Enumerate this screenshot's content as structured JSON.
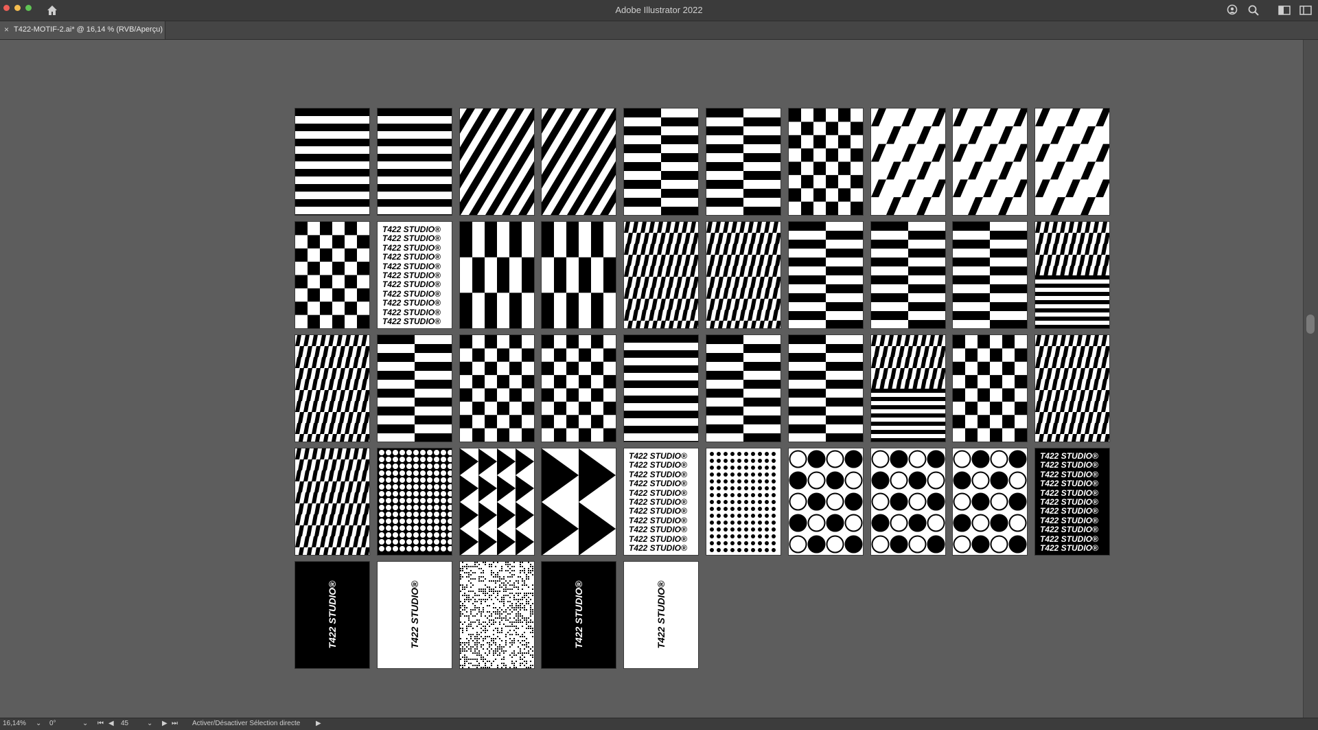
{
  "window": {
    "title": "Adobe Illustrator 2022"
  },
  "tab": {
    "label": "T422-MOTIF-2.ai* @ 16,14 % (RVB/Aperçu)",
    "close_glyph": "×"
  },
  "brand_text": "T422 STUDIO",
  "brand_mark": "®",
  "status": {
    "zoom": "16,14%",
    "rotation": "0°",
    "artboard_number": "45",
    "tool_hint": "Activer/Désactiver Sélection directe"
  },
  "artboard_patterns": [
    "hstripes",
    "hstripes",
    "diag",
    "diag",
    "hcheck",
    "hcheck",
    "check",
    "diagcheck",
    "diagcheck",
    "diagcheck",
    "check",
    "text-white",
    "vcheck",
    "vcheck",
    "skew",
    "skew",
    "hcheck",
    "hcheck",
    "hcheck",
    "mixed",
    "skew",
    "hcheck",
    "check",
    "check",
    "hstripes",
    "hcheck",
    "hcheck",
    "mixed",
    "check",
    "skew",
    "skew",
    "dots-black",
    "triangles",
    "triangles-big",
    "text-white",
    "diamond-dots",
    "circles",
    "circles",
    "circles",
    "text-black",
    "rot-black",
    "rot-white",
    "noise",
    "rot-black",
    "rot-white"
  ],
  "colors": {
    "canvas": "#5d5d5d",
    "ink": "#000000",
    "paper": "#ffffff"
  }
}
